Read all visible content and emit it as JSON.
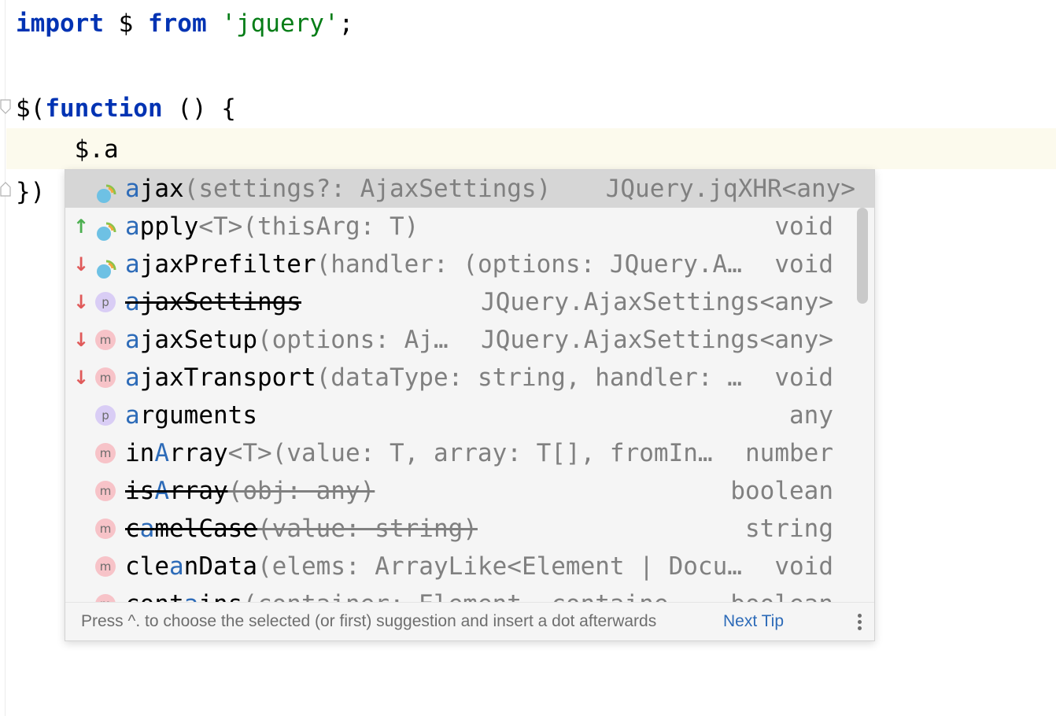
{
  "editor": {
    "lines": [
      {
        "tokens": [
          {
            "text": "import",
            "kind": "kw"
          },
          {
            "text": " $ ",
            "kind": "plain"
          },
          {
            "text": "from",
            "kind": "kw"
          },
          {
            "text": " ",
            "kind": "plain"
          },
          {
            "text": "'jquery'",
            "kind": "str"
          },
          {
            "text": ";",
            "kind": "plain"
          }
        ]
      },
      {
        "tokens": [
          {
            "text": "$(",
            "kind": "plain"
          },
          {
            "text": "function",
            "kind": "kw"
          },
          {
            "text": " () {",
            "kind": "plain"
          }
        ]
      },
      {
        "tokens": [
          {
            "text": "    $.a",
            "kind": "plain"
          }
        ]
      },
      {
        "tokens": [
          {
            "text": "})",
            "kind": "plain"
          }
        ]
      }
    ],
    "typed_prefix": "a"
  },
  "completion": {
    "items": [
      {
        "icon": "method-function-icon",
        "prio": "",
        "prefix": "a",
        "rest": "jax",
        "sig": "(settings?: AjaxSettings)",
        "type": "JQuery.jqXHR<any>",
        "strike": false,
        "selected": true
      },
      {
        "icon": "method-function-icon",
        "prio": "up",
        "prefix": "a",
        "rest": "pply",
        "sig": "<T>(thisArg: T)",
        "type": "void",
        "strike": false,
        "selected": false
      },
      {
        "icon": "method-function-icon",
        "prio": "down",
        "prefix": "a",
        "rest": "jaxPrefilter",
        "sig": "(handler: (options: JQuery.A…",
        "type": "void",
        "strike": false,
        "selected": false
      },
      {
        "icon": "p",
        "prio": "down",
        "prefix": "a",
        "rest": "jaxSettings",
        "sig": "",
        "type": "JQuery.AjaxSettings<any>",
        "strike": true,
        "selected": false
      },
      {
        "icon": "m",
        "prio": "down",
        "prefix": "a",
        "rest": "jaxSetup",
        "sig": "(options: Aj…",
        "type": "JQuery.AjaxSettings<any>",
        "strike": false,
        "selected": false
      },
      {
        "icon": "m",
        "prio": "down",
        "prefix": "a",
        "rest": "jaxTransport",
        "sig": "(dataType: string, handler: …",
        "type": "void",
        "strike": false,
        "selected": false
      },
      {
        "icon": "p",
        "prio": "",
        "prefix": "a",
        "rest": "rguments",
        "sig": "",
        "type": "any",
        "strike": false,
        "selected": false
      },
      {
        "icon": "m",
        "prio": "",
        "pre": "in",
        "prefix": "A",
        "rest": "rray",
        "sig": "<T>(value: T, array: T[], fromIn…",
        "type": "number",
        "strike": false,
        "selected": false
      },
      {
        "icon": "m",
        "prio": "",
        "pre": "is",
        "prefix": "A",
        "rest": "rray",
        "sig": "(obj: any)",
        "type": "boolean",
        "strike": true,
        "selected": false
      },
      {
        "icon": "m",
        "prio": "",
        "pre": "c",
        "prefix": "a",
        "rest": "melCase",
        "sig": "(value: string)",
        "type": "string",
        "strike": true,
        "selected": false
      },
      {
        "icon": "m",
        "prio": "",
        "pre": "cle",
        "prefix": "a",
        "rest": "nData",
        "sig": "(elems: ArrayLike<Element | Docu…",
        "type": "void",
        "strike": false,
        "selected": false
      },
      {
        "icon": "m",
        "prio": "",
        "pre": "cont",
        "prefix": "a",
        "rest": "ins",
        "sig": "(container: Element, containe…",
        "type": "boolean",
        "strike": false,
        "selected": false
      }
    ],
    "footer": {
      "tip": "Press ^. to choose the selected (or first) suggestion and insert a dot afterwards",
      "next_tip": "Next Tip"
    }
  },
  "icons": {
    "prio_up": "↑",
    "prio_down": "↓",
    "m": "m",
    "p": "p"
  }
}
